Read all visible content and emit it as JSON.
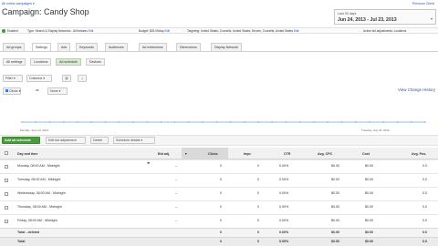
{
  "top": {
    "breadcrumb": "All online campaigns",
    "previous_link": "Previous Client",
    "campaign_prefix": "Campaign:",
    "campaign_name": "Candy Shop",
    "date_label": "Last 30 days",
    "date_range": "Jun 24, 2013 - Jul 23, 2013"
  },
  "settings_bar": {
    "status_label": "Enabled",
    "type_text": "Type: Search & Display Networks - All features",
    "type_edit": "Edit",
    "budget_text": "Budget: $25.00/day",
    "budget_edit": "Edit",
    "targeting_text": "Targeting: United States; Connells, United States; Denver, Connells, United States",
    "targeting_edit": "Edit",
    "active_adj": "Active bid adjustments: Locations"
  },
  "tabs": [
    {
      "label": "Ad groups"
    },
    {
      "label": "Settings"
    },
    {
      "label": "Ads"
    },
    {
      "label": "Keywords"
    },
    {
      "label": "Audiences"
    },
    {
      "label": "Ad extensions"
    },
    {
      "label": "Dimensions"
    },
    {
      "label": "Display Network"
    }
  ],
  "subtabs": [
    {
      "label": "All settings"
    },
    {
      "label": "Locations"
    },
    {
      "label": "Ad schedule"
    },
    {
      "label": "Devices"
    }
  ],
  "toolbar": {
    "filter_label": "Filter",
    "columns_label": "Columns",
    "metric1": "Clicks",
    "vs_label": "vs",
    "metric2": "None",
    "view_change_history": "View Change History"
  },
  "chart": {
    "x_start": "Monday, June 24, 2013",
    "x_end": "Tuesday, July 23, 2013"
  },
  "actions": {
    "add_ad_schedule": "Add ad schedule",
    "edit_bid_adjustment": "Edit bid adjustment",
    "delete_label": "Delete",
    "schedule_details": "Schedule details"
  },
  "table": {
    "columns": [
      "Day and time",
      "Bid adj.",
      "Clicks",
      "Impr.",
      "CTR",
      "Avg. CPC",
      "Cost",
      "Avg. Pos."
    ],
    "rows": [
      {
        "day": "Monday, 08:00 AM - Midnight",
        "bid": "--",
        "clicks": "0",
        "impr": "0",
        "ctr": "0.00%",
        "cpc": "$0.00",
        "cost": "$0.00",
        "pos": "0.0"
      },
      {
        "day": "Tuesday, 08:00 AM - Midnight",
        "bid": "--",
        "clicks": "0",
        "impr": "0",
        "ctr": "0.00%",
        "cpc": "$0.00",
        "cost": "$0.00",
        "pos": "0.0"
      },
      {
        "day": "Wednesday, 08:00 AM - Midnight",
        "bid": "--",
        "clicks": "0",
        "impr": "0",
        "ctr": "0.00%",
        "cpc": "$0.00",
        "cost": "$0.00",
        "pos": "0.0"
      },
      {
        "day": "Thursday, 08:00 AM - Midnight",
        "bid": "--",
        "clicks": "0",
        "impr": "0",
        "ctr": "0.00%",
        "cpc": "$0.00",
        "cost": "$0.00",
        "pos": "0.0"
      },
      {
        "day": "Friday, 08:00 AM - Midnight",
        "bid": "--",
        "clicks": "0",
        "impr": "0",
        "ctr": "0.00%",
        "cpc": "$0.00",
        "cost": "$0.00",
        "pos": "0.0"
      }
    ],
    "total_deleted": {
      "label": "Total - deleted",
      "clicks": "0",
      "impr": "0",
      "ctr": "0.00%",
      "cpc": "$0.00",
      "cost": "$0.00",
      "pos": "0.0"
    },
    "total": {
      "label": "Total",
      "clicks": "0",
      "impr": "0",
      "ctr": "0.00%",
      "cpc": "$0.00",
      "cost": "$0.00",
      "pos": "0.0"
    }
  },
  "colors": {
    "link": "#2255bb",
    "add_button": "#4a9a3e",
    "status_green": "#3c9b3c",
    "chart_line": "#6fa8dc"
  }
}
